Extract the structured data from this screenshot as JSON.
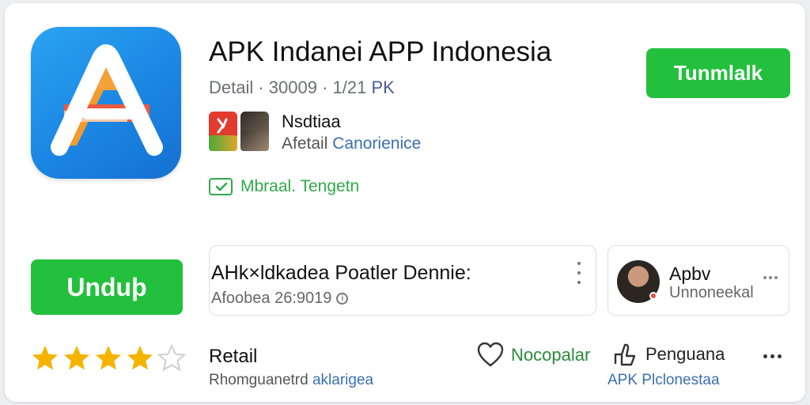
{
  "app": {
    "title": "APK Indanei APP Indonesia",
    "detail_prefix": "Detail · 30009 · 1/21",
    "detail_suffix": "PK",
    "icon": "app-store-a-logo"
  },
  "developer": {
    "name": "Nsdtiaa",
    "sub_prefix": "Afetail",
    "sub_highlight": "Canorienice"
  },
  "verified": {
    "label": "Mbraal. Tengetn",
    "icon": "check-box-icon",
    "color": "#2fa94a"
  },
  "buttons": {
    "top_primary": "Tunmlalk",
    "download": "Unduþ",
    "accent_color": "#22c03c"
  },
  "info_card": {
    "title": "AHk×ldkadea Poatler Dennie:",
    "date": "Afoobea 26:9019",
    "info_icon": "info-icon",
    "menu_icon": "vertical-dots-icon"
  },
  "user_card": {
    "name": "Apbv",
    "subtitle": "Unnoneekal",
    "menu_icon": "horizontal-dots-icon"
  },
  "rating": {
    "value": 4,
    "max": 5,
    "star_color": "#f4b400"
  },
  "section": {
    "title": "Retail",
    "sub_prefix": "Rhomguanetrd",
    "sub_highlight": "aklarigea"
  },
  "actions": {
    "like_label": "Nocopalar",
    "like_icon": "heart-icon",
    "share_label": "Penguana",
    "share_icon": "share-icon",
    "share_sub": "APK Plclonestaa",
    "more_icon": "more-dots-icon"
  }
}
